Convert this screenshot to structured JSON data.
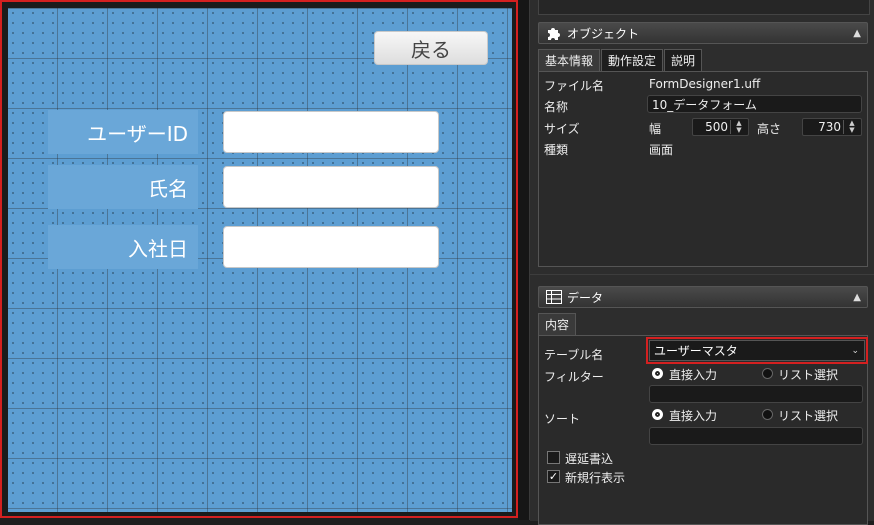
{
  "form": {
    "back_label": "戻る",
    "fields": [
      {
        "label": "ユーザーID"
      },
      {
        "label": "氏名"
      },
      {
        "label": "入社日"
      }
    ]
  },
  "object_panel": {
    "title": "オブジェクト",
    "tabs": [
      "基本情報",
      "動作設定",
      "説明"
    ],
    "file_label": "ファイル名",
    "file_value": "FormDesigner1.uff",
    "name_label": "名称",
    "name_value": "10_データフォーム",
    "size_label": "サイズ",
    "width_label": "幅",
    "width_value": "500",
    "height_label": "高さ",
    "height_value": "730",
    "type_label": "種類",
    "type_value": "画面"
  },
  "data_panel": {
    "title": "データ",
    "tab": "内容",
    "table_label": "テーブル名",
    "table_value": "ユーザーマスタ",
    "filter_label": "フィルター",
    "sort_label": "ソート",
    "direct_input": "直接入力",
    "list_select": "リスト選択",
    "deferred_write": "遅延書込",
    "show_new_row": "新規行表示"
  }
}
